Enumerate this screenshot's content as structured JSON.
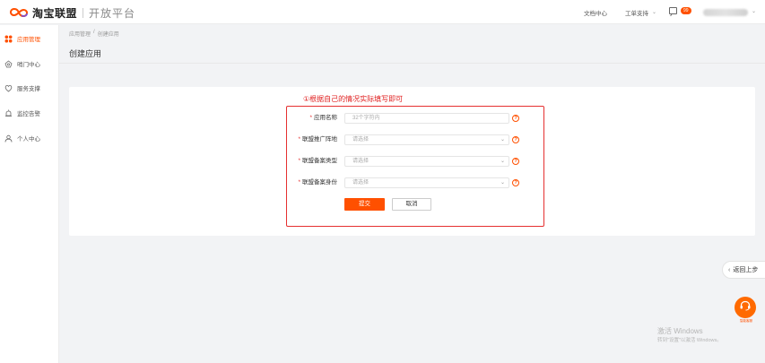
{
  "header": {
    "brand": "淘宝联盟",
    "sub_brand": "开放平台",
    "nav_docs": "文档中心",
    "nav_support": "工单支持",
    "nav_support_caret": "⌄",
    "message_badge": "99",
    "user_caret": "⌄"
  },
  "sidebar": {
    "items": [
      {
        "label": "应用管理",
        "icon": "app-grid-icon"
      },
      {
        "label": "哨门中心",
        "icon": "gift-icon"
      },
      {
        "label": "服务支撑",
        "icon": "heart-shield-icon"
      },
      {
        "label": "监控告警",
        "icon": "alarm-icon"
      },
      {
        "label": "个人中心",
        "icon": "user-icon"
      }
    ]
  },
  "breadcrumb": {
    "items": [
      "应用管理",
      "/",
      "创建应用"
    ]
  },
  "page": {
    "title": "创建应用"
  },
  "annotation": "①根据自己的情况实际填写即可",
  "form": {
    "app_name": {
      "label": "应用名称",
      "placeholder": "32个字符内"
    },
    "promo_site": {
      "label": "联盟推广阵地",
      "placeholder": "请选择"
    },
    "filing_type": {
      "label": "联盟备案类型",
      "placeholder": "请选择"
    },
    "filing_identity": {
      "label": "联盟备案身份",
      "placeholder": "请选择"
    },
    "required_mark": "*",
    "help_glyph": "?",
    "chevron": "⌄",
    "submit_label": "提交",
    "cancel_label": "取消"
  },
  "floating": {
    "back_label": "返回上步",
    "back_arrow": "‹",
    "service_label": "智能客服"
  },
  "watermark": {
    "title": "激活 Windows",
    "subtitle": "转到\"设置\"以激活 Windows。"
  },
  "colors": {
    "accent": "#ff5000",
    "annotation_red": "#e53030"
  }
}
